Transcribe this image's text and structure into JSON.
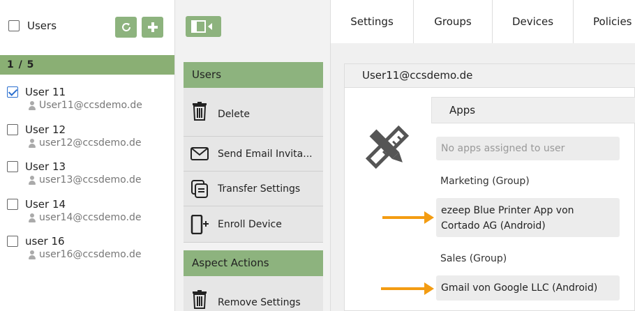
{
  "users_pane": {
    "header_label": "Users",
    "counter": "1 / 5",
    "users": [
      {
        "name": "User 11",
        "email": "User11@ccsdemo.de",
        "checked": true
      },
      {
        "name": "User 12",
        "email": "user12@ccsdemo.de",
        "checked": false
      },
      {
        "name": "User 13",
        "email": "user13@ccsdemo.de",
        "checked": false
      },
      {
        "name": "User 14",
        "email": "user14@ccsdemo.de",
        "checked": false
      },
      {
        "name": "user 16",
        "email": "user16@ccsdemo.de",
        "checked": false
      }
    ]
  },
  "actions_pane": {
    "users_section": "Users",
    "actions": [
      {
        "label": "Delete",
        "icon": "trash-icon"
      },
      {
        "label": "Send Email Invita...",
        "icon": "envelope-icon"
      },
      {
        "label": "Transfer Settings",
        "icon": "copy-icon"
      },
      {
        "label": "Enroll Device",
        "icon": "phone-add-icon"
      }
    ],
    "aspect_section": "Aspect Actions",
    "aspect_actions": [
      {
        "label": "Remove Settings",
        "icon": "trash-icon"
      }
    ]
  },
  "detail_pane": {
    "tabs": [
      "Settings",
      "Groups",
      "Devices",
      "Policies"
    ],
    "panel_title": "User11@ccsdemo.de",
    "apps_heading": "Apps",
    "no_apps_text": "No apps assigned to user",
    "groups": [
      {
        "label": "Marketing (Group)",
        "apps": [
          "ezeep Blue Printer App von Cortado AG (Android)"
        ]
      },
      {
        "label": "Sales (Group)",
        "apps": [
          "Gmail von Google LLC (Android)"
        ]
      }
    ]
  },
  "colors": {
    "accent_green": "#8db37e",
    "counter_green": "#8aaf74",
    "arrow_orange": "#f39c12",
    "check_blue": "#2a6fcf"
  }
}
